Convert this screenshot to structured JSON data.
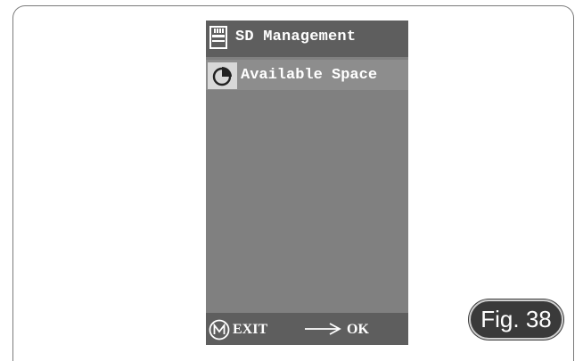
{
  "screen": {
    "header": {
      "icon": "sd-card-icon",
      "title": "SD Management"
    },
    "menu": {
      "items": [
        {
          "icon": "pie-chart-icon",
          "label": "Available Space",
          "selected": true
        }
      ]
    },
    "footer": {
      "exit_icon": "m-circle-icon",
      "exit_label": "EXIT",
      "ok_icon": "right-arrow-icon",
      "ok_label": "OK"
    }
  },
  "figure": {
    "label": "Fig. 38"
  },
  "colors": {
    "screen_bg": "#808080",
    "bar_bg": "#5e5e5e",
    "selected_icon_bg": "#d8d8d8",
    "text": "#ffffff",
    "fig_badge_bg": "#3a3a3a"
  }
}
